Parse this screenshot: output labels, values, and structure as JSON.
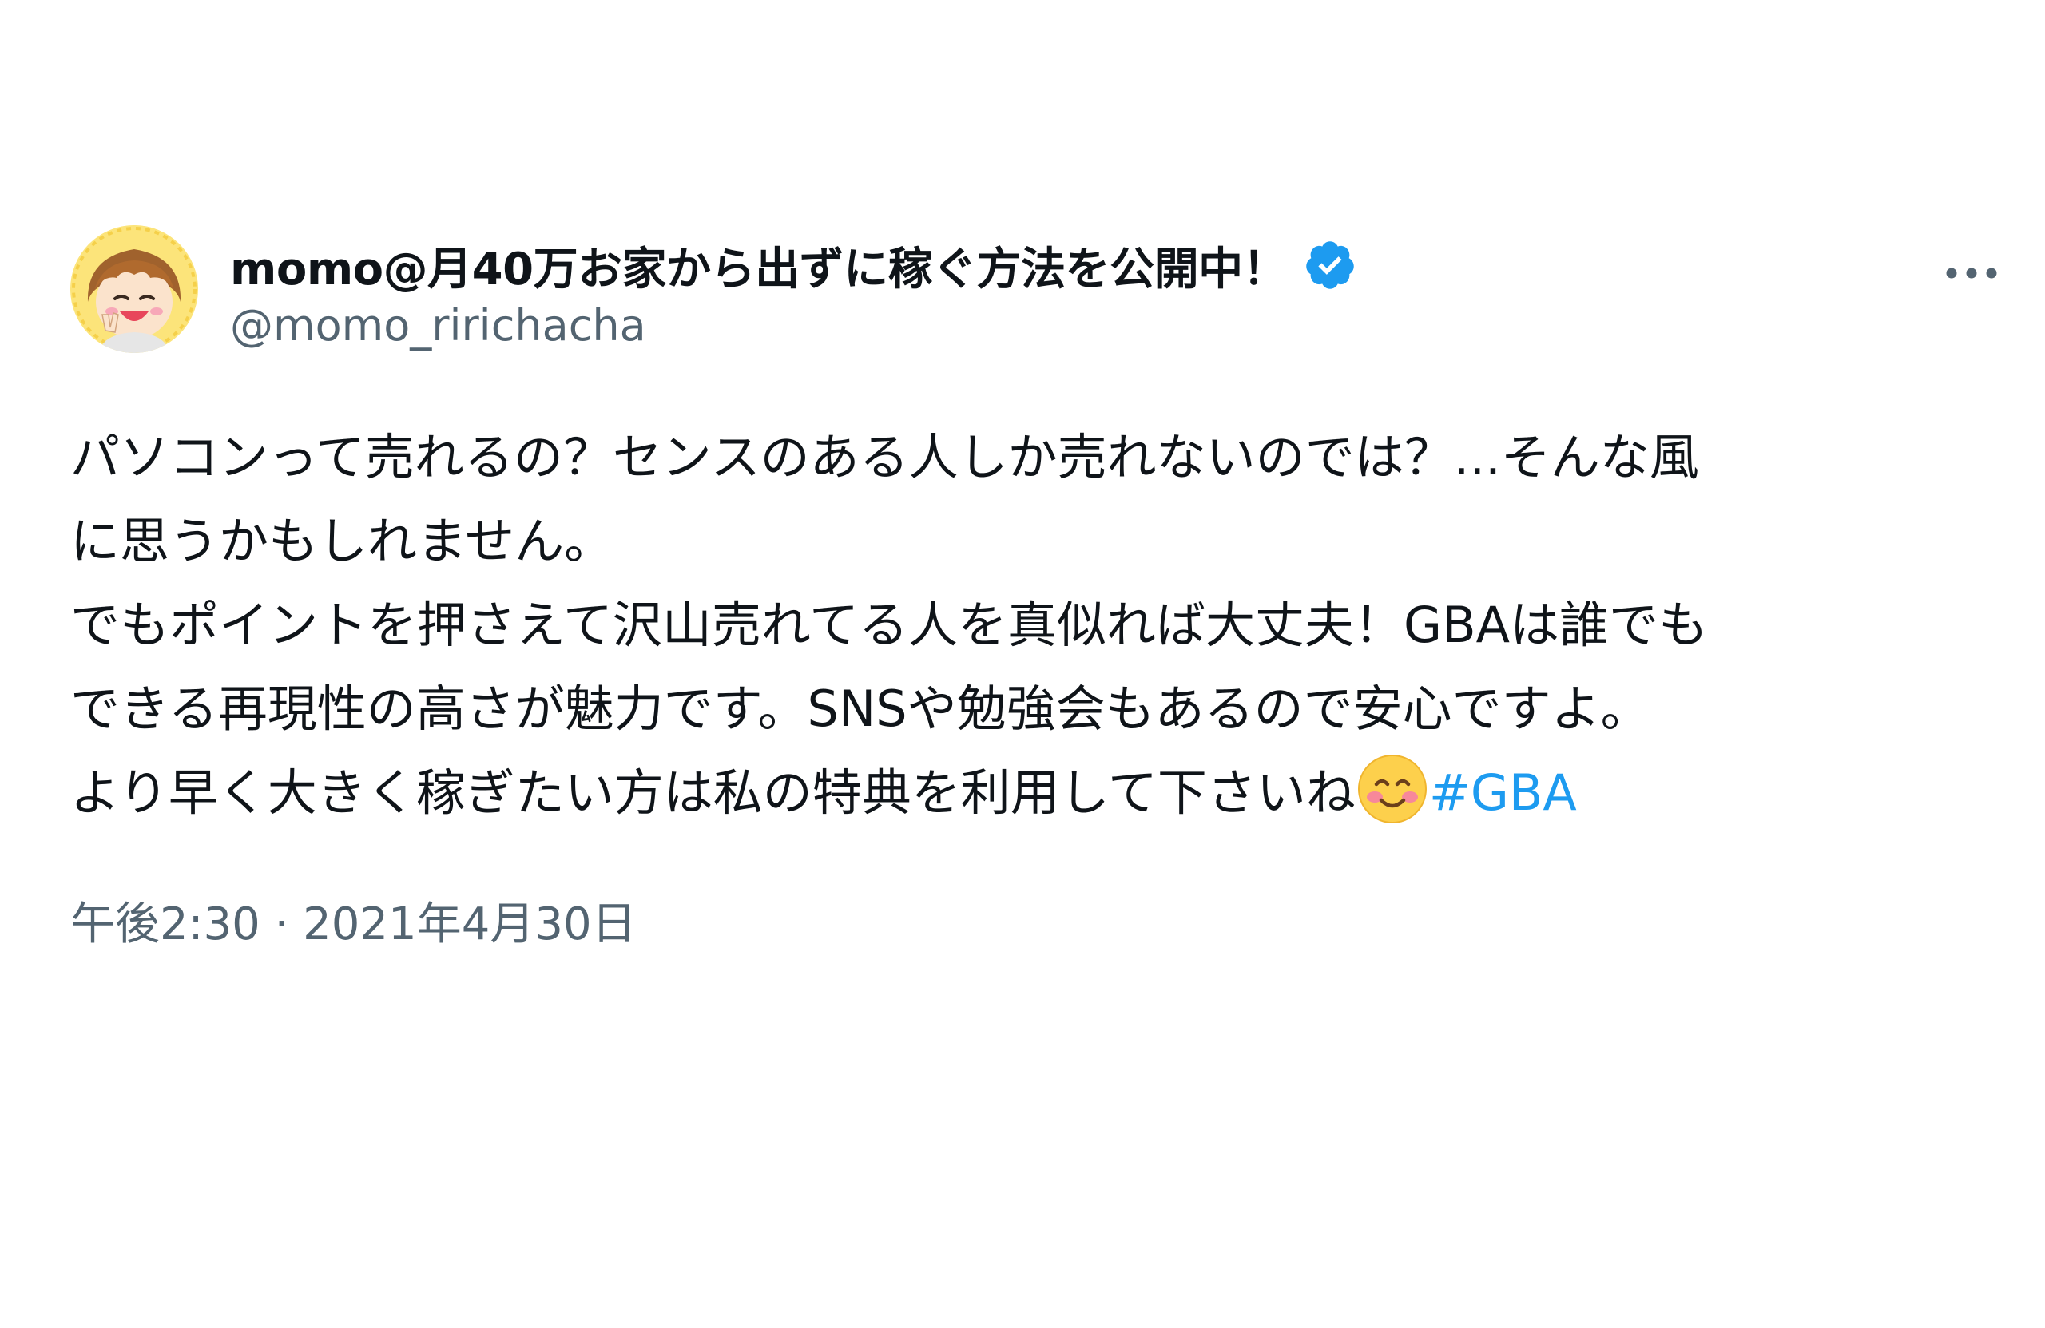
{
  "user": {
    "display_name": "momo@月40万お家から出ずに稼ぐ方法を公開中！",
    "handle": "@momo_ririchacha"
  },
  "tweet": {
    "lines": [
      "パソコンって売れるの？センスのある人しか売れないのでは？...そんな風",
      "に思うかもしれません。",
      "でもポイントを押さえて沢山売れてる人を真似れば大丈夫！GBAは誰でも",
      "できる再現性の高さが魅力です。SNSや勉強会もあるので安心ですよ。",
      "より早く大きく稼ぎたい方は私の特典を利用して下さいね"
    ],
    "emoji": "smiling-face-with-smiling-eyes-emoji",
    "hashtag": "#GBA"
  },
  "timestamp": {
    "time": "午後2:30",
    "separator": " · ",
    "date": "2021年4月30日"
  },
  "colors": {
    "text": "#0f1419",
    "secondary": "#536471",
    "link": "#1d9bf0",
    "verified": "#1d9bf0"
  },
  "icons": {
    "verified": "verified-badge-icon",
    "more": "more-options-icon",
    "avatar": "avatar"
  }
}
